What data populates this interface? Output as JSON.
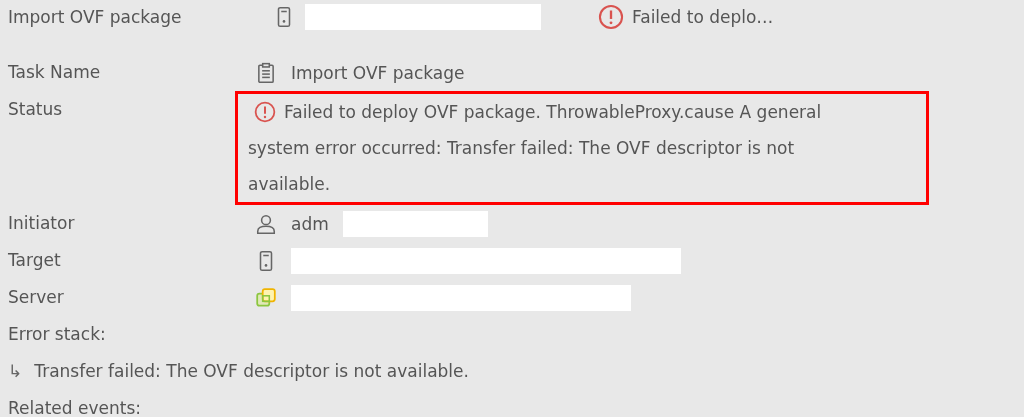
{
  "header": {
    "task": "Import OVF package",
    "target_redacted": true,
    "status": "Failed to deplo…"
  },
  "details": [
    {
      "label": "Task Name",
      "kind": "clipboard",
      "value": "Import OVF package",
      "redacted": false,
      "highlighted": false
    },
    {
      "label": "Status",
      "kind": "error",
      "value": "Failed to deploy OVF package. ThrowableProxy.cause A general system error occurred: Transfer failed: The OVF descriptor is not available.",
      "highlighted": true
    },
    {
      "label": "Initiator",
      "kind": "user",
      "value": "adm",
      "redacted": true,
      "highlighted": false
    },
    {
      "label": "Target",
      "kind": "server",
      "redacted": true,
      "highlighted": false
    },
    {
      "label": "Server",
      "kind": "vcenter",
      "redacted": true,
      "highlighted": false
    }
  ],
  "error_stack": {
    "label": "Error stack:",
    "arrow": "↳",
    "message": "Transfer failed: The OVF descriptor is not available."
  },
  "related_events": {
    "label": "Related events:"
  }
}
